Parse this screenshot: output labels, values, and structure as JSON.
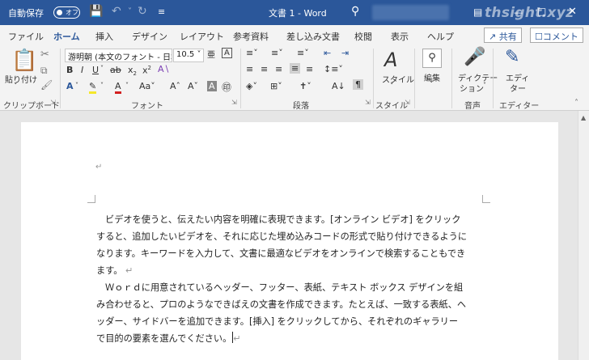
{
  "titlebar": {
    "autosave_label": "自動保存",
    "autosave_state": "オフ",
    "doc_title": "文書 1  -  Word",
    "watermark": "thsight.xyz"
  },
  "tabs": [
    "ファイル",
    "ホーム",
    "挿入",
    "デザイン",
    "レイアウト",
    "参考資料",
    "差し込み文書",
    "校閲",
    "表示",
    "ヘルプ"
  ],
  "active_tab": "ホーム",
  "share": {
    "share_label": "共有",
    "comment_label": "コメント"
  },
  "ribbon": {
    "paste_label": "貼り付け",
    "font_name": "游明朝 (本文のフォント - 日本",
    "font_size": "10.5",
    "style_label": "スタイル",
    "edit_label": "編集",
    "dictate_label1": "ディクテー",
    "dictate_label2": "ション",
    "editor_label1": "エディ",
    "editor_label2": "ター",
    "groups": {
      "clipboard": "クリップボード",
      "font": "フォント",
      "paragraph": "段落",
      "styles": "スタイル",
      "voice": "音声",
      "editor": "エディター"
    }
  },
  "document": {
    "lines": [
      "ビデオを使うと、伝えたい内容を明確に表現できます。[オンライン ビデオ] をクリック",
      "すると、追加したいビデオを、それに応じた埋め込みコードの形式で貼り付けできるように",
      "なります。キーワードを入力して、文書に最適なビデオをオンラインで検索することもでき",
      "ます。",
      "Ｗｏｒｄに用意されているヘッダー、フッター、表紙、テキスト ボックス デザインを組",
      "み合わせると、プロのようなできばえの文書を作成できます。たとえば、一致する表紙、ヘ",
      "ッダー、サイドバーを追加できます。[挿入] をクリックしてから、それぞれのギャラリー",
      "で目的の要素を選んでください。"
    ]
  }
}
